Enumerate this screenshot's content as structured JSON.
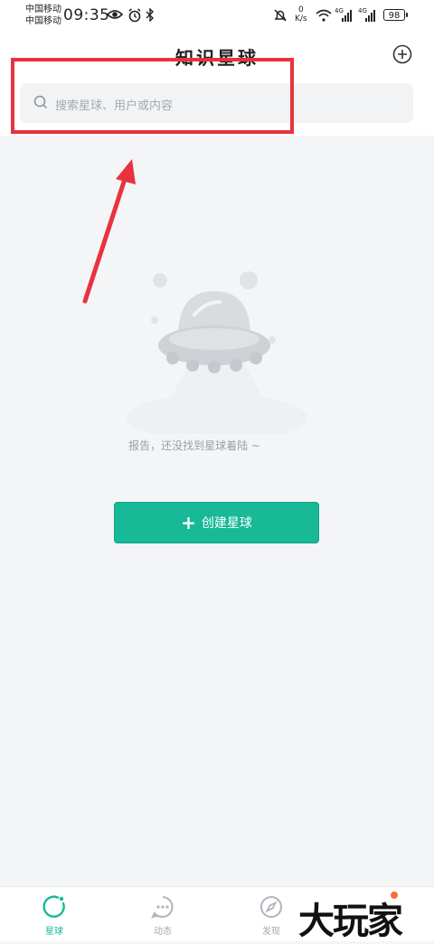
{
  "status_bar": {
    "carrier_line1": "中国移动",
    "carrier_line2": "中国移动",
    "time": "09:35",
    "net_speed_value": "0",
    "net_speed_unit": "K/s",
    "signal1_label": "4G",
    "signal2_label": "4G",
    "battery": "98"
  },
  "header": {
    "title": "知识星球",
    "add_icon": "plus-circle-icon"
  },
  "search": {
    "placeholder": "搜索星球、用户或内容",
    "icon": "search-icon"
  },
  "empty_state": {
    "illustration": "ufo-illustration",
    "message": "报告，还没找到星球着陆 ~"
  },
  "create_button": {
    "label": "创建星球",
    "color": "#17b996"
  },
  "annotation": {
    "box_color": "#e8333f"
  },
  "tabbar": {
    "items": [
      {
        "label": "星球",
        "icon": "planet-icon",
        "active": true
      },
      {
        "label": "动态",
        "icon": "chat-icon",
        "active": false
      },
      {
        "label": "发现",
        "icon": "compass-icon",
        "active": false
      }
    ]
  },
  "watermark": {
    "text": "大玩家"
  }
}
